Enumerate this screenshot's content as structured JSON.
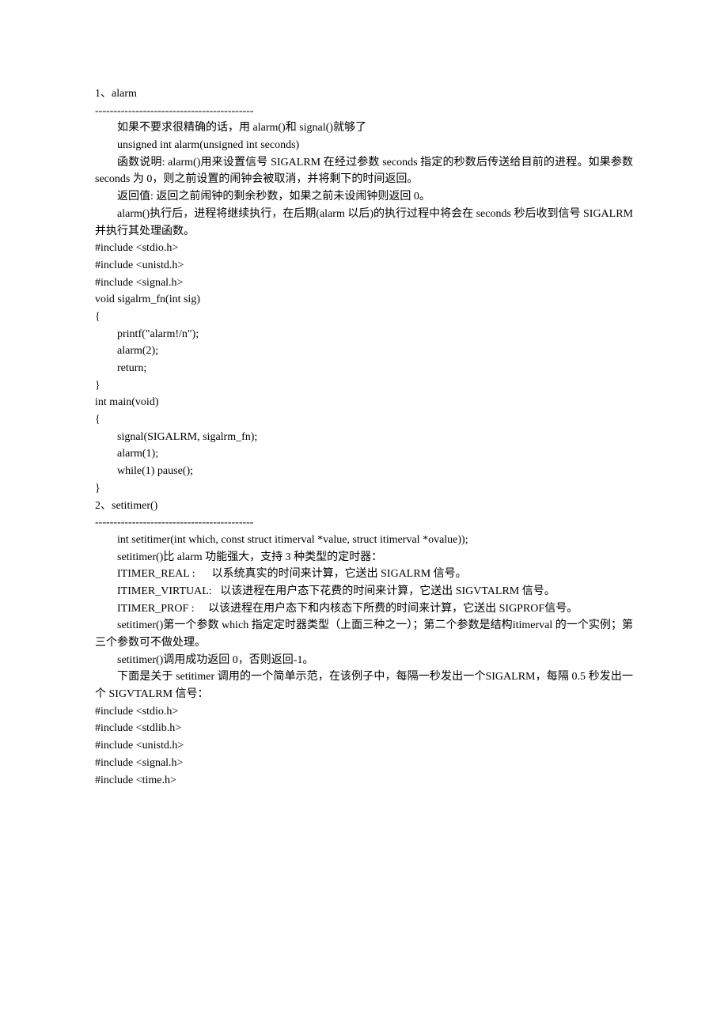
{
  "lines": [
    {
      "cls": "noindent",
      "t": "1、alarm"
    },
    {
      "cls": "noindent",
      "t": "-------------------------------------------"
    },
    {
      "cls": "indent",
      "t": "如果不要求很精确的话，用 alarm()和 signal()就够了"
    },
    {
      "cls": "indent",
      "t": "unsigned int alarm(unsigned int seconds)"
    },
    {
      "cls": "indent",
      "t": "函数说明: alarm()用来设置信号 SIGALRM 在经过参数 seconds 指定的秒数后传送给目前的进程。如果参数 seconds 为 0，则之前设置的闹钟会被取消，并将剩下的时间返回。"
    },
    {
      "cls": "indent",
      "t": "返回值: 返回之前闹钟的剩余秒数，如果之前未设闹钟则返回 0。"
    },
    {
      "cls": "indent",
      "t": "alarm()执行后，进程将继续执行，在后期(alarm 以后)的执行过程中将会在 seconds 秒后收到信号 SIGALRM 并执行其处理函数。"
    },
    {
      "cls": "noindent",
      "t": "#include <stdio.h>"
    },
    {
      "cls": "noindent",
      "t": "#include <unistd.h>"
    },
    {
      "cls": "noindent",
      "t": "#include <signal.h>"
    },
    {
      "cls": "noindent",
      "t": "void sigalrm_fn(int sig)"
    },
    {
      "cls": "noindent",
      "t": "{"
    },
    {
      "cls": "indent",
      "t": "printf(\"alarm!/n\");"
    },
    {
      "cls": "indent",
      "t": "alarm(2);"
    },
    {
      "cls": "indent",
      "t": "return;"
    },
    {
      "cls": "noindent",
      "t": "}"
    },
    {
      "cls": "noindent",
      "t": "int main(void)"
    },
    {
      "cls": "noindent",
      "t": "{"
    },
    {
      "cls": "indent",
      "t": "signal(SIGALRM, sigalrm_fn);"
    },
    {
      "cls": "indent",
      "t": "alarm(1);"
    },
    {
      "cls": "indent",
      "t": "while(1) pause();"
    },
    {
      "cls": "noindent",
      "t": "}"
    },
    {
      "cls": "noindent",
      "t": "2、setitimer()"
    },
    {
      "cls": "noindent",
      "t": "-------------------------------------------"
    },
    {
      "cls": "indent",
      "t": "int setitimer(int which, const struct itimerval *value, struct itimerval *ovalue));"
    },
    {
      "cls": "indent",
      "t": "setitimer()比 alarm 功能强大，支持 3 种类型的定时器："
    },
    {
      "cls": "indent",
      "t": "ITIMER_REAL :      以系统真实的时间来计算，它送出 SIGALRM 信号。"
    },
    {
      "cls": "indent",
      "t": "ITIMER_VIRTUAL:   以该进程在用户态下花费的时间来计算，它送出 SIGVTALRM 信号。"
    },
    {
      "cls": "indent",
      "t": "ITIMER_PROF :     以该进程在用户态下和内核态下所费的时间来计算，它送出 SIGPROF信号。"
    },
    {
      "cls": "indent",
      "t": "setitimer()第一个参数 which 指定定时器类型（上面三种之一）；第二个参数是结构itimerval 的一个实例；第三个参数可不做处理。"
    },
    {
      "cls": "indent",
      "t": "setitimer()调用成功返回 0，否则返回-1。"
    },
    {
      "cls": "noindent",
      "t": ""
    },
    {
      "cls": "indent",
      "t": "下面是关于 setitimer 调用的一个简单示范，在该例子中，每隔一秒发出一个SIGALRM，每隔 0.5 秒发出一个 SIGVTALRM 信号："
    },
    {
      "cls": "noindent",
      "t": "#include <stdio.h>"
    },
    {
      "cls": "noindent",
      "t": "#include <stdlib.h>"
    },
    {
      "cls": "noindent",
      "t": "#include <unistd.h>"
    },
    {
      "cls": "noindent",
      "t": "#include <signal.h>"
    },
    {
      "cls": "noindent",
      "t": "#include <time.h>"
    }
  ]
}
